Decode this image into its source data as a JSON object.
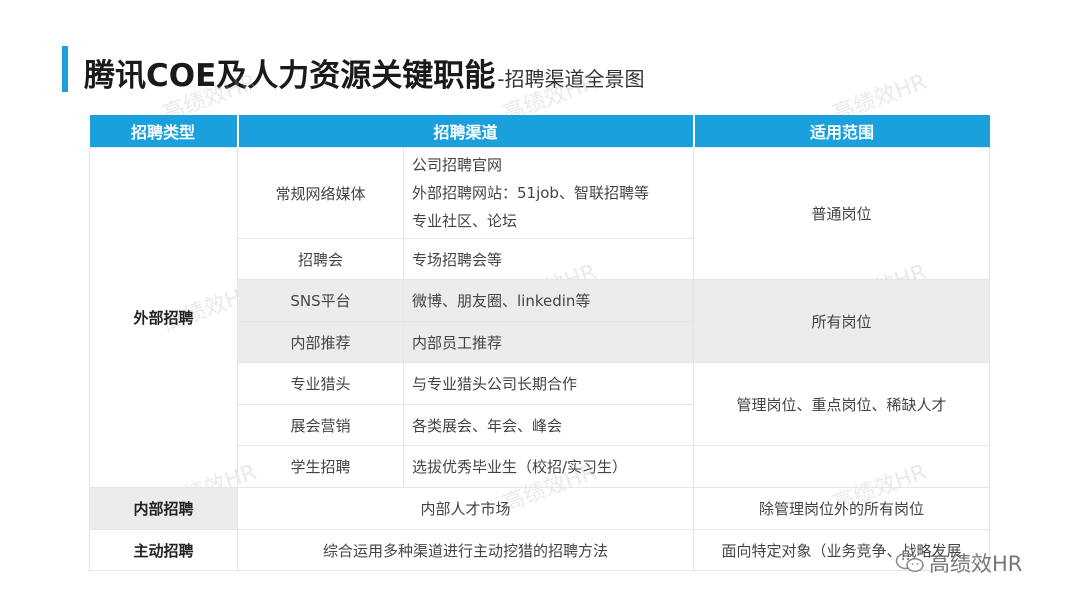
{
  "header": {
    "title_main": "腾讯COE及人力资源关键职能",
    "title_sub": "-招聘渠道全景图"
  },
  "table": {
    "headers": [
      "招聘类型",
      "招聘渠道",
      "适用范围"
    ],
    "external_type": "外部招聘",
    "rows": [
      {
        "channel": "常规网络媒体",
        "details": [
          "公司招聘官网",
          "外部招聘网站：51job、智联招聘等",
          "专业社区、论坛"
        ]
      },
      {
        "channel": "招聘会",
        "details": [
          "专场招聘会等"
        ]
      },
      {
        "channel": "SNS平台",
        "details": [
          "微博、朋友圈、linkedin等"
        ]
      },
      {
        "channel": "内部推荐",
        "details": [
          "内部员工推荐"
        ]
      },
      {
        "channel": "专业猎头",
        "details": [
          "与专业猎头公司长期合作"
        ]
      },
      {
        "channel": "展会营销",
        "details": [
          "各类展会、年会、峰会"
        ]
      },
      {
        "channel": "学生招聘",
        "details": [
          "选拔优秀毕业生（校招/实习生）"
        ]
      }
    ],
    "scopes": [
      "普通岗位",
      "所有岗位",
      "管理岗位、重点岗位、稀缺人才"
    ],
    "internal": {
      "type": "内部招聘",
      "channel": "内部人才市场",
      "scope": "除管理岗位外的所有岗位"
    },
    "active": {
      "type": "主动招聘",
      "channel": "综合运用多种渠道进行主动挖猎的招聘方法",
      "scope": "面向特定对象（业务竞争、战略发展"
    }
  },
  "watermark": {
    "text": "高绩效HR"
  },
  "footer": {
    "brand": "高绩效HR"
  }
}
